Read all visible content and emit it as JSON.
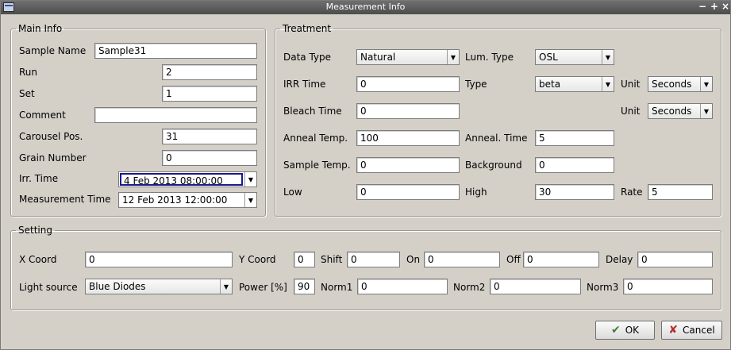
{
  "window": {
    "title": "Measurement Info",
    "controls": [
      "minimize",
      "maximize",
      "close"
    ]
  },
  "main_info": {
    "legend": "Main Info",
    "sample_name_label": "Sample Name",
    "sample_name": "Sample31",
    "run_label": "Run",
    "run": "2",
    "set_label": "Set",
    "set": "1",
    "comment_label": "Comment",
    "comment": "",
    "carousel_label": "Carousel Pos.",
    "carousel": "31",
    "grain_label": "Grain Number",
    "grain": "0",
    "irr_time_label": "Irr. Time",
    "irr_time": "4 Feb 2013 08:00:00",
    "meas_time_label": "Measurement Time",
    "meas_time": "12 Feb 2013 12:00:00"
  },
  "treatment": {
    "legend": "Treatment",
    "data_type_label": "Data Type",
    "data_type": "Natural",
    "lum_type_label": "Lum. Type",
    "lum_type": "OSL",
    "irr_time_label": "IRR Time",
    "irr_time": "0",
    "type_label": "Type",
    "type": "beta",
    "unit_label": "Unit",
    "unit1": "Seconds",
    "bleach_label": "Bleach Time",
    "bleach": "0",
    "unit2": "Seconds",
    "anneal_temp_label": "Anneal Temp.",
    "anneal_temp": "100",
    "anneal_time_label": "Anneal. Time",
    "anneal_time": "5",
    "sample_temp_label": "Sample Temp.",
    "sample_temp": "0",
    "background_label": "Background",
    "background": "0",
    "low_label": "Low",
    "low": "0",
    "high_label": "High",
    "high": "30",
    "rate_label": "Rate",
    "rate": "5"
  },
  "setting": {
    "legend": "Setting",
    "x_label": "X Coord",
    "x": "0",
    "y_label": "Y Coord",
    "y": "0",
    "shift_label": "Shift",
    "shift": "0",
    "on_label": "On",
    "on": "0",
    "off_label": "Off",
    "off": "0",
    "delay_label": "Delay",
    "delay": "0",
    "light_label": "Light source",
    "light": "Blue Diodes",
    "power_label": "Power [%]",
    "power": "90",
    "norm1_label": "Norm1",
    "norm1": "0",
    "norm2_label": "Norm2",
    "norm2": "0",
    "norm3_label": "Norm3",
    "norm3": "0"
  },
  "buttons": {
    "ok": "OK",
    "cancel": "Cancel"
  }
}
